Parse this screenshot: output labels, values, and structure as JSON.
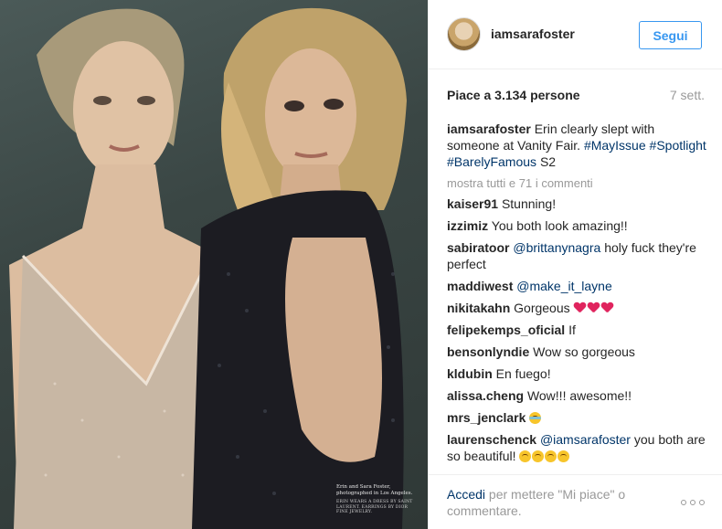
{
  "photo": {
    "caption_line1": "Erin and Sara Foster, photographed in Los Angeles.",
    "caption_line2": "ERIN WEARS A DRESS BY SAINT LAURENT. EARRINGS BY DIOR FINE JEWELRY."
  },
  "header": {
    "username": "iamsarafoster",
    "follow_label": "Segui"
  },
  "stats": {
    "likes": "Piace a 3.134 persone",
    "time": "7 sett."
  },
  "caption": {
    "username": "iamsarafoster",
    "text": "Erin clearly slept with someone at Vanity Fair.",
    "tags": [
      "#MayIssue",
      "#Spotlight",
      "#BarelyFamous"
    ],
    "suffix": "S2"
  },
  "show_all": "mostra tutti e 71 i commenti",
  "comments": [
    {
      "user": "kaiser91",
      "text": "Stunning!"
    },
    {
      "user": "izzimiz",
      "text": "You both look amazing!!"
    },
    {
      "user": "sabiratoor",
      "mention": "@brittanynagra",
      "text": "holy fuck they're perfect"
    },
    {
      "user": "maddiwest",
      "mention": "@make_it_layne",
      "text": ""
    },
    {
      "user": "nikitakahn",
      "text": "Gorgeous"
    },
    {
      "user": "felipekemps_oficial",
      "text": "If"
    },
    {
      "user": "bensonlyndie",
      "text": "Wow so gorgeous"
    },
    {
      "user": "kldubin",
      "text": "En fuego!"
    },
    {
      "user": "alissa.cheng",
      "text": "Wow!!! awesome!!"
    },
    {
      "user": "mrs_jenclark",
      "text": ""
    },
    {
      "user": "laurenschenck",
      "mention": "@iamsarafoster",
      "text": "you both are so beautiful!"
    }
  ],
  "footer": {
    "login_label": "Accedi",
    "text": "per mettere \"Mi piace\" o commentare."
  },
  "icons": {
    "more": "more-options-icon",
    "heart": "heart-emoji-icon",
    "smile": "heart-eyes-emoji-icon",
    "laugh": "tears-of-joy-emoji-icon"
  },
  "colors": {
    "link": "#003569",
    "accent": "#3897f0",
    "muted": "#999999"
  }
}
